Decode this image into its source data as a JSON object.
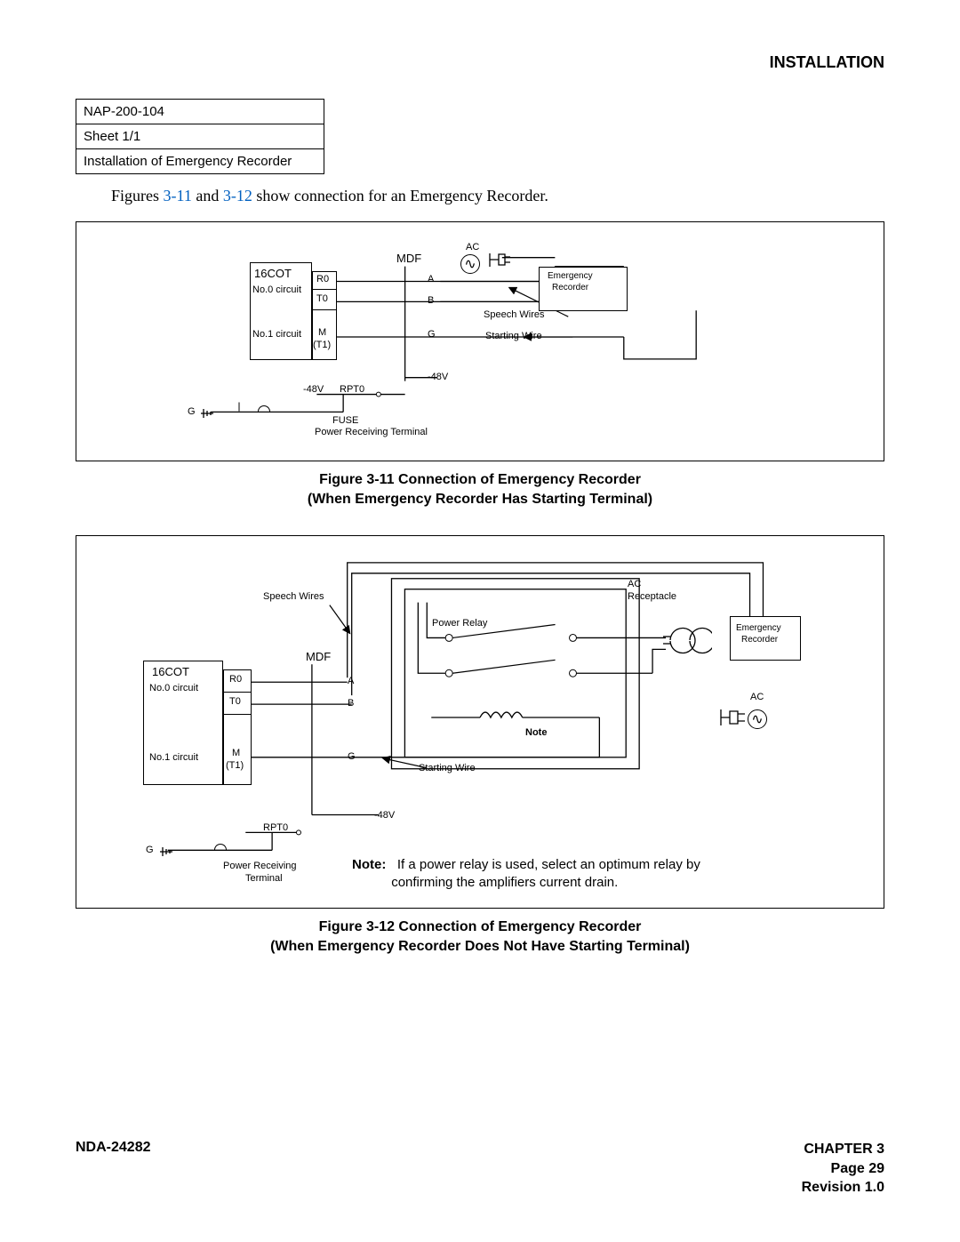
{
  "header": {
    "section": "INSTALLATION"
  },
  "infobox": {
    "nap": "NAP-200-104",
    "sheet": "Sheet 1/1",
    "title": "Installation of Emergency Recorder"
  },
  "intro": {
    "prefix": "Figures ",
    "ref1": "3-11",
    "mid": " and ",
    "ref2": "3-12",
    "suffix": " show connection for an Emergency Recorder."
  },
  "fig1": {
    "labels": {
      "cot": "16COT",
      "circ0": "No.0 circuit",
      "circ1": "No.1 circuit",
      "r0": "R0",
      "t0": "T0",
      "m": "M",
      "t1": "(T1)",
      "mdf": "MDF",
      "a": "A",
      "b": "B",
      "g": "G",
      "ac": "AC",
      "emerg1": "Emergency",
      "emerg2": "Recorder",
      "speech": "Speech Wires",
      "starting": "Starting Wire",
      "minus48v": "-48V",
      "minus48v2": "-48V",
      "rpt0": "RPT0",
      "fuse": "FUSE",
      "g2": "G",
      "prt": "Power Receiving Terminal"
    },
    "caption_l1": "Figure 3-11   Connection of Emergency Recorder",
    "caption_l2": "(When Emergency Recorder Has Starting Terminal)"
  },
  "fig2": {
    "labels": {
      "cot": "16COT",
      "circ0": "No.0 circuit",
      "circ1": "No.1 circuit",
      "r0": "R0",
      "t0": "T0",
      "m": "M",
      "t1": "(T1)",
      "mdf": "MDF",
      "a": "A",
      "b": "B",
      "g": "G",
      "speech": "Speech Wires",
      "starting": "Starting Wire",
      "power_relay": "Power Relay",
      "note_tag": "Note",
      "ac_recpt1": "AC",
      "ac_recpt2": "Receptacle",
      "emerg1": "Emergency",
      "emerg2": "Recorder",
      "ac2": "AC",
      "minus48v": "-48V",
      "rpt0": "RPT0",
      "g2": "G",
      "prt1": "Power Receiving",
      "prt2": "Terminal"
    },
    "note": {
      "lead": "Note:",
      "text1": "If a power relay is used, select an optimum relay by",
      "text2": "confirming the amplifiers current drain."
    },
    "caption_l1": "Figure 3-12   Connection of Emergency Recorder",
    "caption_l2": "(When Emergency Recorder Does Not Have Starting Terminal)"
  },
  "footer": {
    "docnum": "NDA-24282",
    "chapter": "CHAPTER 3",
    "page": "Page 29",
    "rev": "Revision 1.0"
  }
}
